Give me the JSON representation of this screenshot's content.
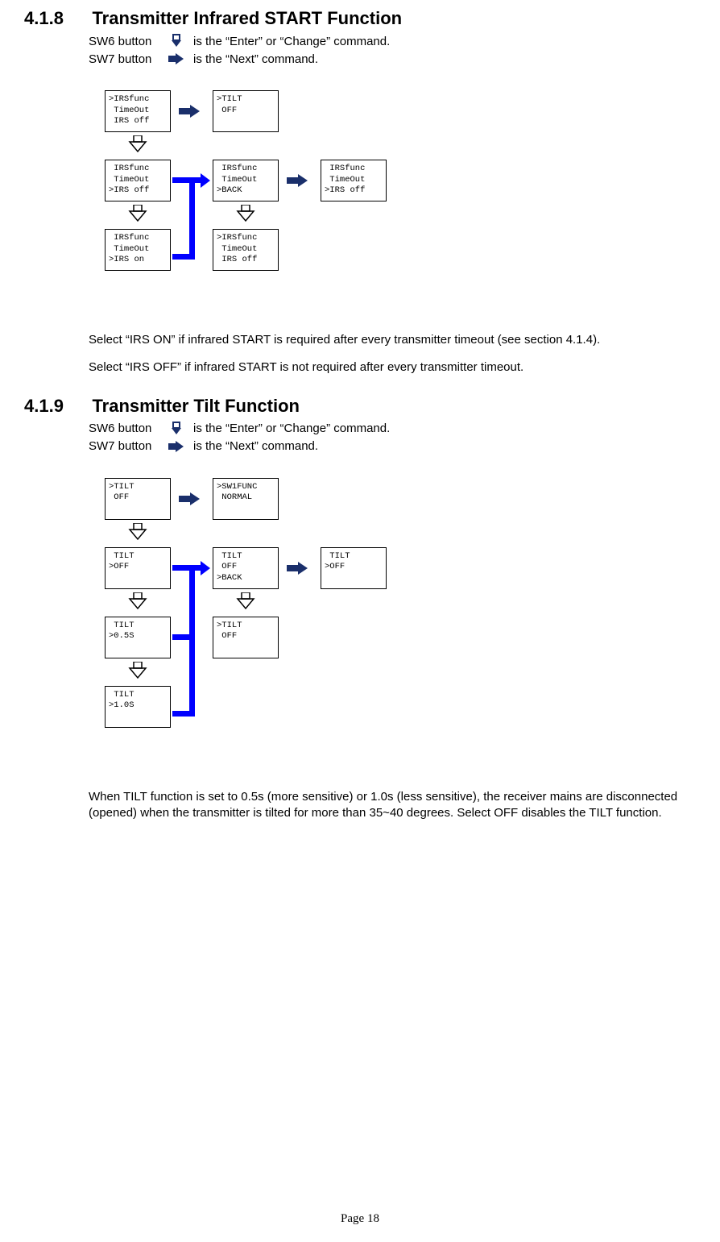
{
  "section418": {
    "num": "4.1.8",
    "title": "Transmitter Infrared START Function",
    "sw6_before": "SW6 button",
    "sw6_after": "is the “Enter” or “Change” command.",
    "sw7_before": "SW7 button",
    "sw7_after": "is the “Next” command.",
    "boxes": {
      "r0c0": ">IRSfunc\n TimeOut\n IRS off",
      "r0c1": ">TILT\n OFF",
      "r1c0": " IRSfunc\n TimeOut\n>IRS off",
      "r1c1": " IRSfunc\n TimeOut\n>BACK",
      "r1c2": " IRSfunc\n TimeOut\n>IRS off",
      "r2c0": " IRSfunc\n TimeOut\n>IRS on",
      "r2c1": ">IRSfunc\n TimeOut\n IRS off"
    },
    "para1": "Select “IRS ON” if infrared START is required after every transmitter timeout (see section 4.1.4).",
    "para2": "Select “IRS OFF” if infrared START is not required after every transmitter timeout."
  },
  "section419": {
    "num": "4.1.9",
    "title": "Transmitter Tilt Function",
    "sw6_before": "SW6 button",
    "sw6_after": "is the “Enter” or “Change” command.",
    "sw7_before": "SW7 button",
    "sw7_after": "is the “Next” command.",
    "boxes": {
      "r0c0": ">TILT\n OFF",
      "r0c1": ">SW1FUNC\n NORMAL",
      "r1c0": " TILT\n>OFF",
      "r1c1": " TILT\n OFF\n>BACK",
      "r1c2": " TILT\n>OFF",
      "r2c0": " TILT\n>0.5S",
      "r2c1": ">TILT\n OFF",
      "r3c0": " TILT\n>1.0S"
    },
    "para": "When TILT function is set to 0.5s (more sensitive) or 1.0s (less sensitive), the receiver mains are disconnected (opened) when the transmitter is tilted for more than 35~40 degrees. Select OFF disables the TILT function."
  },
  "footer": "Page 18"
}
